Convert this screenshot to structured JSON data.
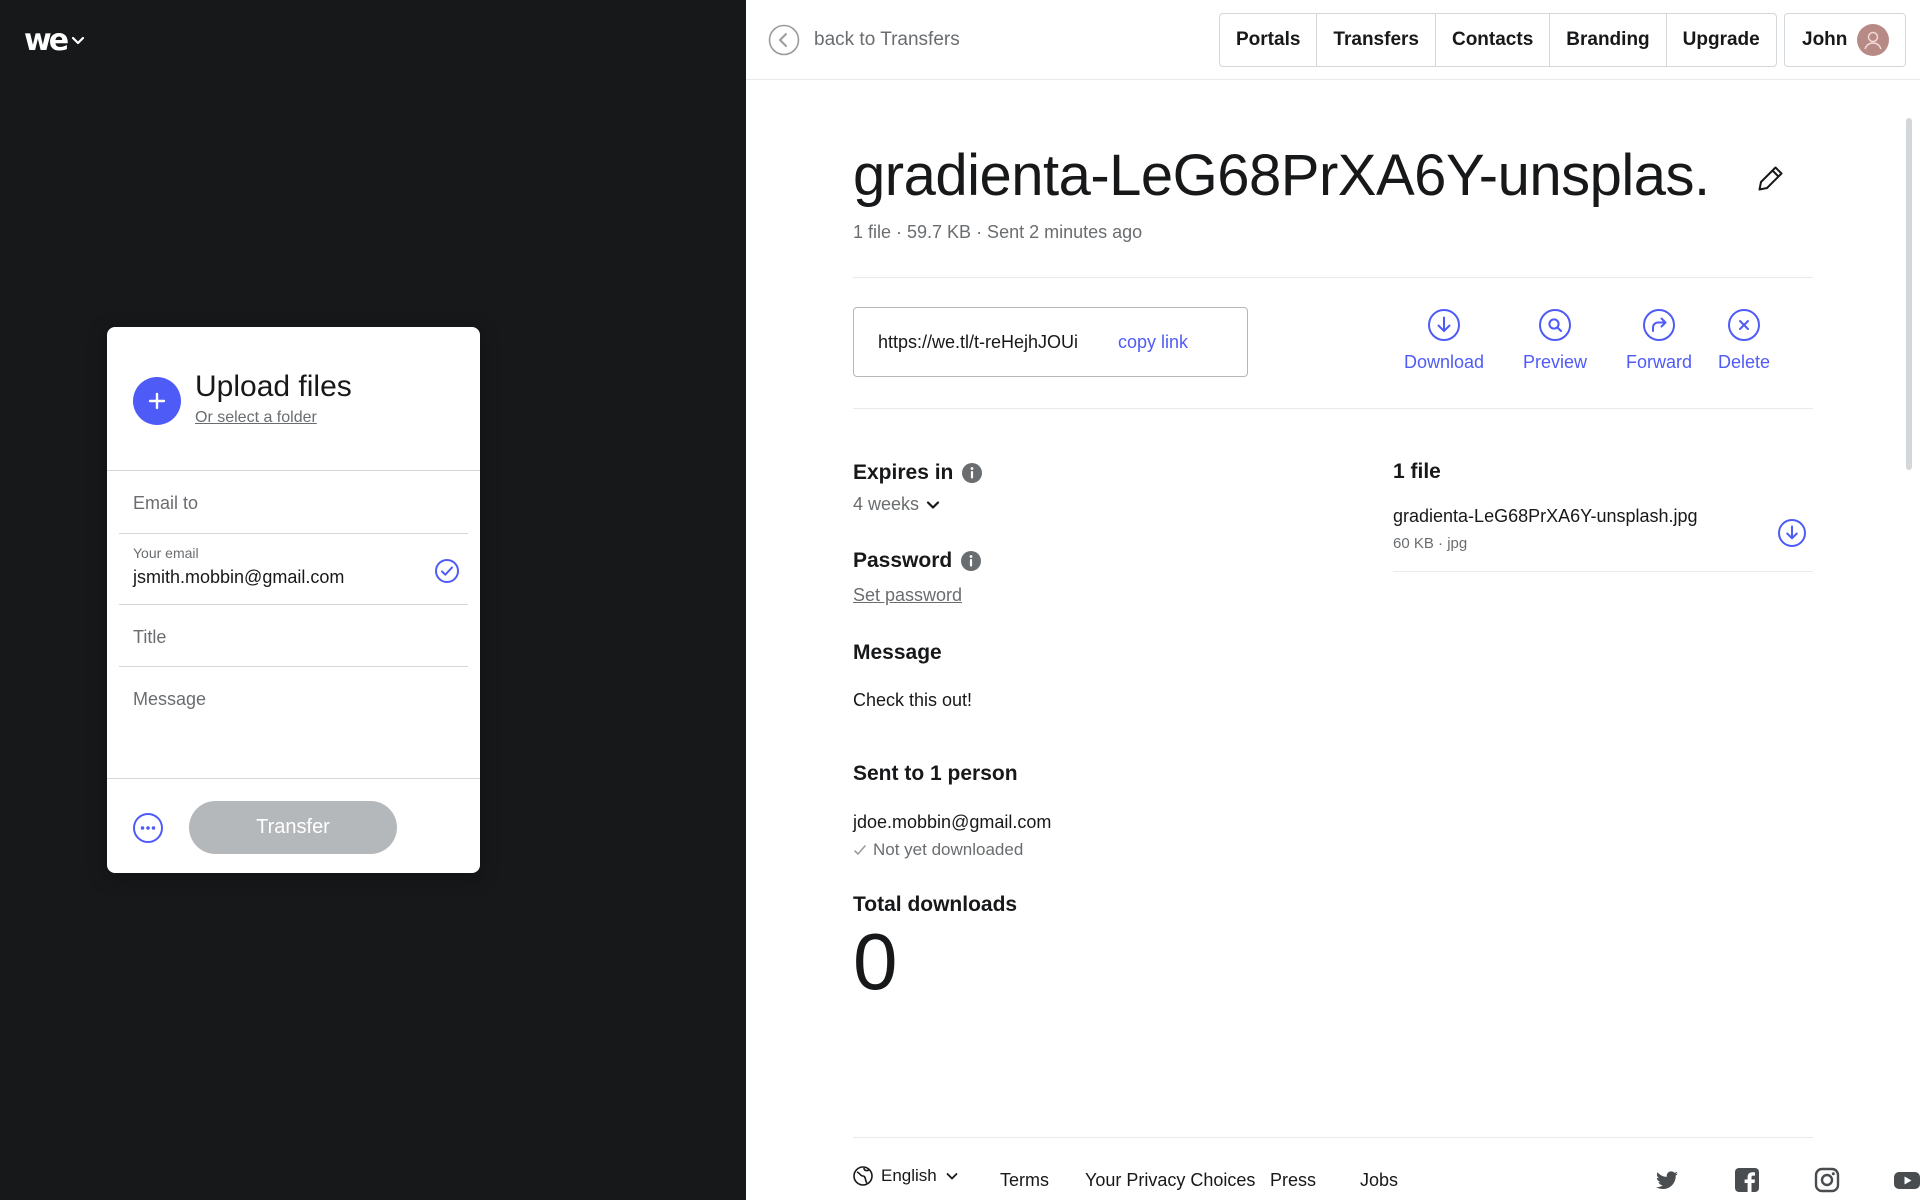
{
  "brand": {
    "logo_text": "we",
    "accent": "#4f5bf7"
  },
  "upload": {
    "title": "Upload files",
    "select_folder": "Or select a folder",
    "email_to_placeholder": "Email to",
    "your_email_label": "Your email",
    "your_email_value": "jsmith.mobbin@gmail.com",
    "title_placeholder": "Title",
    "message_placeholder": "Message",
    "transfer_label": "Transfer"
  },
  "topbar": {
    "back_label": "back to Transfers",
    "nav": [
      "Portals",
      "Transfers",
      "Contacts",
      "Branding",
      "Upgrade"
    ],
    "user_name": "John"
  },
  "transfer": {
    "title": "gradienta-LeG68PrXA6Y-unsplas...",
    "meta": "1 file · 59.7 KB · Sent 2 minutes ago",
    "link": "https://we.tl/t-reHejhJOUi",
    "copy_label": "copy link",
    "actions": [
      "Download",
      "Preview",
      "Forward",
      "Delete"
    ],
    "expires_label": "Expires in",
    "expires_value": "4 weeks",
    "password_label": "Password",
    "password_action": "Set password",
    "message_label": "Message",
    "message_value": "Check this out!",
    "sent_to_label": "Sent to 1 person",
    "recipient": "jdoe.mobbin@gmail.com",
    "recipient_status": "Not yet downloaded",
    "total_label": "Total downloads",
    "total_value": "0",
    "files_label": "1 file",
    "file_name": "gradienta-LeG68PrXA6Y-unsplash.jpg",
    "file_meta": "60 KB · jpg"
  },
  "footer": {
    "language": "English",
    "links": [
      "Terms",
      "Your Privacy Choices",
      "Press",
      "Jobs"
    ],
    "social_icons": [
      "twitter-icon",
      "facebook-icon",
      "instagram-icon",
      "youtube-icon"
    ]
  }
}
